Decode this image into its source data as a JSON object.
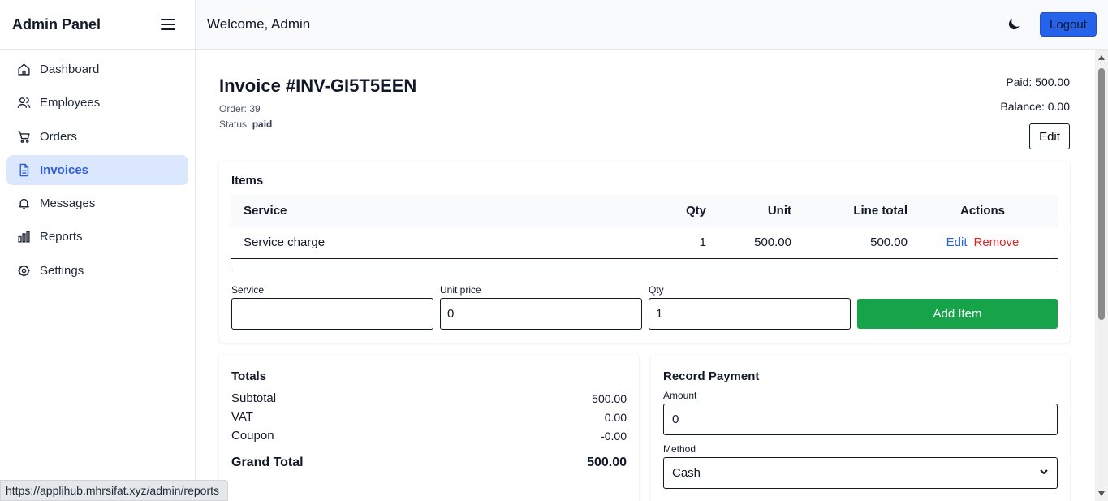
{
  "sidebar": {
    "brand": "Admin Panel",
    "items": [
      {
        "label": "Dashboard",
        "icon": "home-icon"
      },
      {
        "label": "Employees",
        "icon": "users-icon"
      },
      {
        "label": "Orders",
        "icon": "cart-icon"
      },
      {
        "label": "Invoices",
        "icon": "document-icon",
        "active": true
      },
      {
        "label": "Messages",
        "icon": "bell-icon"
      },
      {
        "label": "Reports",
        "icon": "bar-chart-icon"
      },
      {
        "label": "Settings",
        "icon": "gear-icon"
      }
    ]
  },
  "topbar": {
    "welcome": "Welcome, Admin",
    "logout_label": "Logout",
    "theme_icon": "moon-icon"
  },
  "invoice": {
    "title": "Invoice #INV-GI5T5EEN",
    "order_label": "Order:",
    "order_value": "39",
    "status_label": "Status:",
    "status_value": "paid",
    "paid": "Paid: 500.00",
    "balance": "Balance: 0.00",
    "edit_label": "Edit"
  },
  "items": {
    "title": "Items",
    "columns": [
      "Service",
      "Qty",
      "Unit",
      "Line total",
      "Actions"
    ],
    "rows": [
      {
        "service": "Service charge",
        "qty": "1",
        "unit": "500.00",
        "line_total": "500.00",
        "edit": "Edit",
        "remove": "Remove"
      }
    ],
    "form": {
      "service_label": "Service",
      "service_value": "",
      "unit_price_label": "Unit price",
      "unit_price_value": "0",
      "qty_label": "Qty",
      "qty_value": "1",
      "add_label": "Add Item"
    }
  },
  "totals": {
    "title": "Totals",
    "subtotal_label": "Subtotal",
    "subtotal": "500.00",
    "vat_label": "VAT",
    "vat": "0.00",
    "coupon_label": "Coupon",
    "coupon": "-0.00",
    "grand_label": "Grand Total",
    "grand": "500.00"
  },
  "payment": {
    "title": "Record Payment",
    "amount_label": "Amount",
    "amount_value": "0",
    "method_label": "Method",
    "method_value": "Cash"
  },
  "status_bar": {
    "url": "https://applihub.mhrsifat.xyz/admin/reports"
  },
  "colors": {
    "accent": "#2563eb",
    "active_bg": "#dbe7fd",
    "success": "#16a34a",
    "danger": "#dc2626"
  }
}
